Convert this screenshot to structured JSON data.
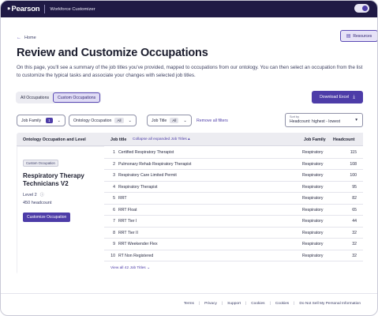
{
  "header": {
    "logo": "Pearson",
    "app_title": "Workforce Customizer",
    "resources_label": "Resources"
  },
  "nav": {
    "back_label": "Home"
  },
  "page": {
    "title": "Review and Customize Occupations",
    "intro": "On this page, you'll see a summary of the job titles you've provided, mapped to occupations from our ontology. You can then select an occupation from the list to customize the typical tasks and associate your changes with selected job titles."
  },
  "tabs": [
    {
      "label": "All Occupations",
      "active": false
    },
    {
      "label": "Custom Occupations",
      "active": true
    }
  ],
  "download_label": "Download Excel",
  "filters": {
    "job_family_label": "Job Family",
    "job_family_count": "1",
    "ontology_label": "Ontology Occupation",
    "ontology_value": "All",
    "job_title_label": "Job Title",
    "job_title_value": "All",
    "remove_all_label": "Remove all filters"
  },
  "sort": {
    "label": "Sort by",
    "value": "Headcount: highest - lowest"
  },
  "left_panel": {
    "header": "Ontology Occupation and Level",
    "tag": "Custom Occupation",
    "occupation_name": "Respiratory Therapy Technicians V2",
    "level": "Level 2",
    "headcount": "450 headcount",
    "customize_label": "Customize Occupation"
  },
  "table": {
    "col_job_title": "Job title",
    "collapse_label": "Collapse all expanded Job Titles",
    "col_job_family": "Job Family",
    "col_headcount": "Headcount",
    "rows": [
      {
        "num": "1",
        "title": "Certified Respiratory Therapist",
        "family": "Respiratory",
        "headcount": "115"
      },
      {
        "num": "2",
        "title": "Pulmonary Rehab Respiratory Therapist",
        "family": "Respiratory",
        "headcount": "108"
      },
      {
        "num": "3",
        "title": "Respiratory Care Limited Permit",
        "family": "Respiratory",
        "headcount": "100"
      },
      {
        "num": "4",
        "title": "Respiratory Therapist",
        "family": "Respiratory",
        "headcount": "95"
      },
      {
        "num": "5",
        "title": "RRT",
        "family": "Respiratory",
        "headcount": "82"
      },
      {
        "num": "6",
        "title": "RRT Float",
        "family": "Respiratory",
        "headcount": "65"
      },
      {
        "num": "7",
        "title": "RRT Tier I",
        "family": "Respiratory",
        "headcount": "44"
      },
      {
        "num": "8",
        "title": "RRT Tier II",
        "family": "Respiratory",
        "headcount": "32"
      },
      {
        "num": "9",
        "title": "RRT Weekender Flex",
        "family": "Respiratory",
        "headcount": "32"
      },
      {
        "num": "10",
        "title": "RT Non Registered",
        "family": "Respiratory",
        "headcount": "32"
      }
    ],
    "view_all_label": "View all 42 Job Titles"
  },
  "footer": {
    "links": [
      "Terms",
      "Privacy",
      "Support",
      "Cookies",
      "Cookies",
      "Do Not Sell My Personal Information"
    ]
  },
  "colors": {
    "header_bg": "#201a45",
    "accent": "#4d3ca8",
    "panel_bg": "#ececf1"
  }
}
